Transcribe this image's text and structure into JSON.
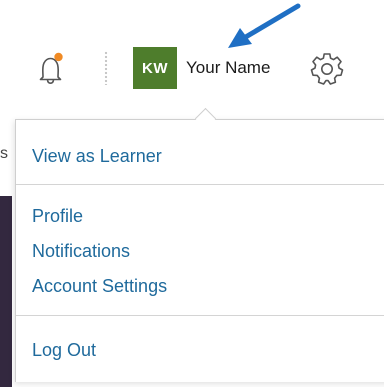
{
  "header": {
    "notifications_icon": "bell-icon",
    "notification_dot_color": "#f08a24",
    "avatar_initials": "KW",
    "avatar_color": "#4e7d2c",
    "user_name": "Your Name",
    "settings_icon": "gear-icon"
  },
  "annotation": {
    "arrow_color": "#1f6fc4",
    "arrow_icon": "arrow-icon"
  },
  "page": {
    "edge_char": "s"
  },
  "menu": {
    "items": [
      {
        "label": "View as Learner"
      },
      {
        "label": "Profile"
      },
      {
        "label": "Notifications"
      },
      {
        "label": "Account Settings"
      },
      {
        "label": "Log Out"
      }
    ]
  }
}
